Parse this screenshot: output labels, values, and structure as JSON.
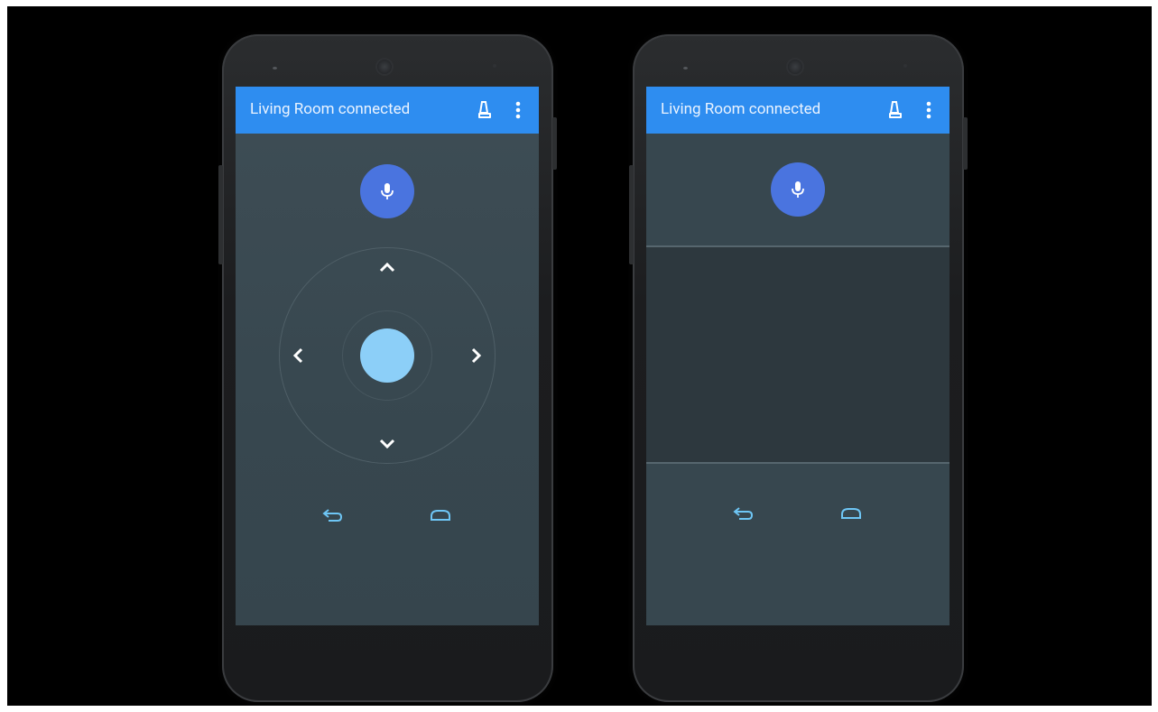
{
  "phones": [
    {
      "mode": "dpad",
      "appbar": {
        "title": "Living Room connected",
        "cast_icon": "cast-connected-icon",
        "menu_icon": "more-vert-icon"
      },
      "mic_icon": "microphone-icon",
      "dpad": {
        "up_icon": "chevron-up-icon",
        "down_icon": "chevron-down-icon",
        "left_icon": "chevron-left-icon",
        "right_icon": "chevron-right-icon",
        "center": "select-button"
      },
      "nav": {
        "back_icon": "back-icon",
        "home_icon": "home-icon"
      }
    },
    {
      "mode": "touchpad",
      "appbar": {
        "title": "Living Room connected",
        "cast_icon": "cast-connected-icon",
        "menu_icon": "more-vert-icon"
      },
      "mic_icon": "microphone-icon",
      "nav": {
        "back_icon": "back-icon",
        "home_icon": "home-icon"
      }
    }
  ],
  "colors": {
    "appbar": "#2e8df0",
    "background": "#37474f",
    "touchpad": "#2d383e",
    "mic": "#4a74df",
    "dpad_center": "#8ccff8",
    "nav_icons": "#6ec6f5"
  }
}
